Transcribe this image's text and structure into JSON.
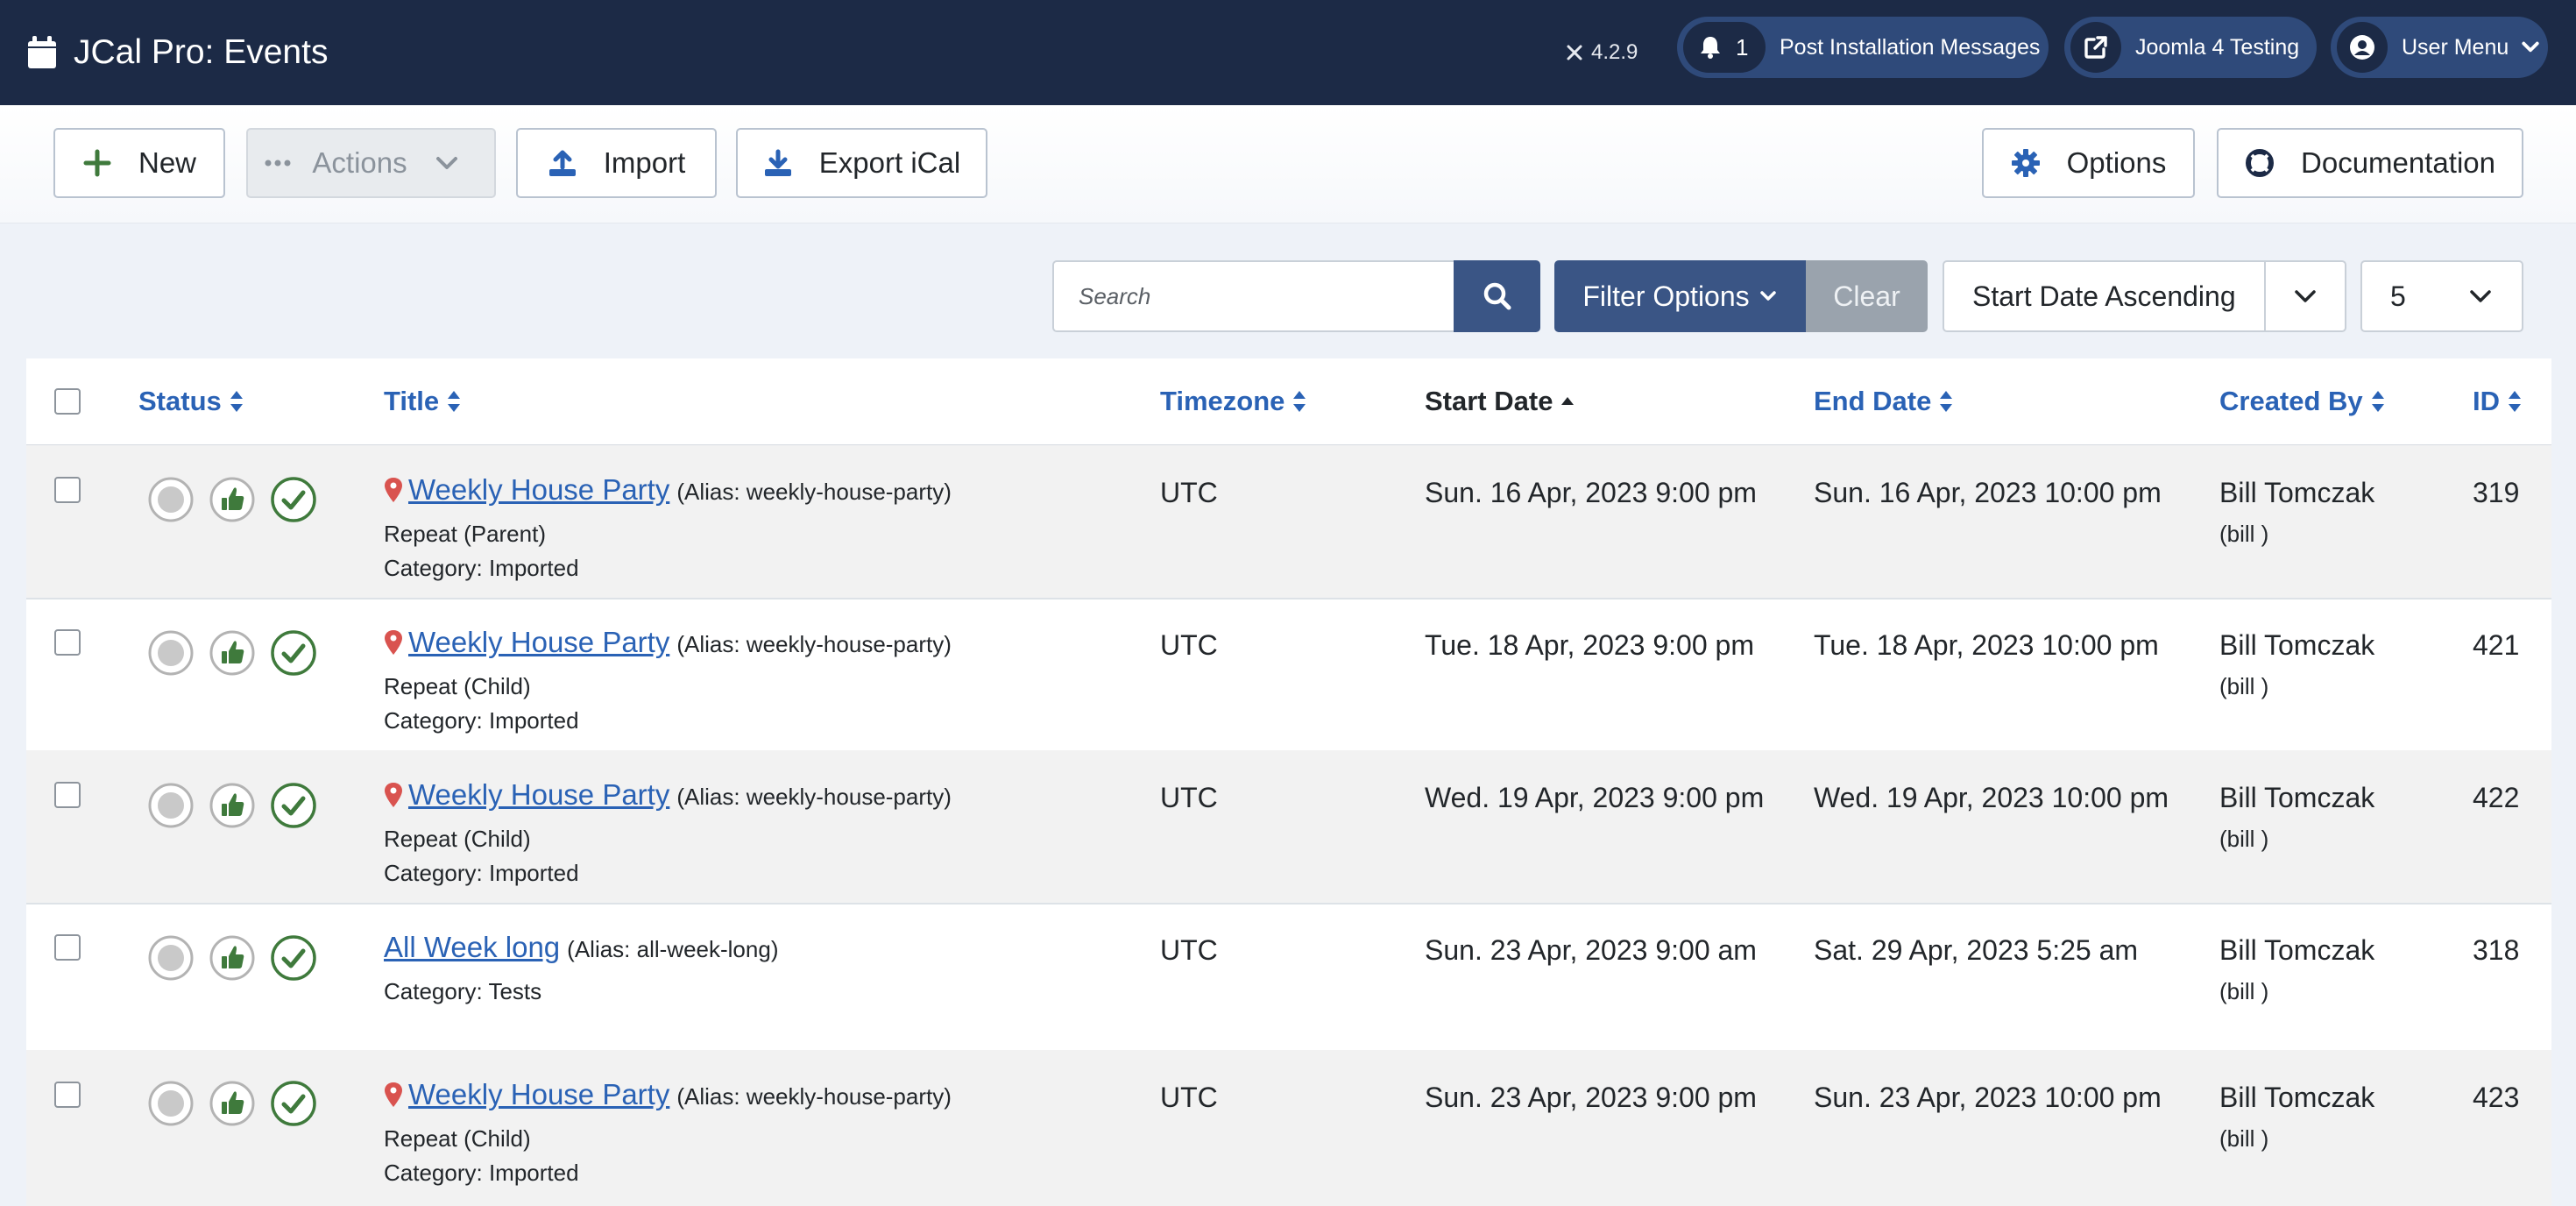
{
  "header": {
    "title": "JCal Pro: Events",
    "version": "4.2.9",
    "notifications": {
      "count": "1",
      "label": "Post Installation Messages"
    },
    "site_link": "Joomla 4 Testing",
    "user_menu": "User Menu"
  },
  "toolbar": {
    "new": "New",
    "actions": "Actions",
    "import": "Import",
    "export": "Export iCal",
    "options": "Options",
    "documentation": "Documentation"
  },
  "filters": {
    "search_placeholder": "Search",
    "filter_options": "Filter Options",
    "clear": "Clear",
    "ordering": "Start Date Ascending",
    "limit": "5"
  },
  "table": {
    "columns": {
      "status": "Status",
      "title": "Title",
      "timezone": "Timezone",
      "start": "Start Date",
      "end": "End Date",
      "created_by": "Created By",
      "id": "ID"
    },
    "rows": [
      {
        "title": "Weekly House Party",
        "alias": "(Alias: weekly-house-party)",
        "repeat": "Repeat (Parent)",
        "category": "Category: Imported",
        "timezone": "UTC",
        "start": "Sun. 16 Apr, 2023 9:00 pm",
        "end": "Sun. 16 Apr, 2023 10:00 pm",
        "creator": "Bill Tomczak",
        "username": "(bill )",
        "id": "319",
        "has_location": true
      },
      {
        "title": "Weekly House Party",
        "alias": "(Alias: weekly-house-party)",
        "repeat": "Repeat (Child)",
        "category": "Category: Imported",
        "timezone": "UTC",
        "start": "Tue. 18 Apr, 2023 9:00 pm",
        "end": "Tue. 18 Apr, 2023 10:00 pm",
        "creator": "Bill Tomczak",
        "username": "(bill )",
        "id": "421",
        "has_location": true
      },
      {
        "title": "Weekly House Party",
        "alias": "(Alias: weekly-house-party)",
        "repeat": "Repeat (Child)",
        "category": "Category: Imported",
        "timezone": "UTC",
        "start": "Wed. 19 Apr, 2023 9:00 pm",
        "end": "Wed. 19 Apr, 2023 10:00 pm",
        "creator": "Bill Tomczak",
        "username": "(bill )",
        "id": "422",
        "has_location": true
      },
      {
        "title": "All Week long",
        "alias": "(Alias: all-week-long)",
        "repeat": "",
        "category": "Category: Tests",
        "timezone": "UTC",
        "start": "Sun. 23 Apr, 2023 9:00 am",
        "end": "Sat. 29 Apr, 2023 5:25 am",
        "creator": "Bill Tomczak",
        "username": "(bill )",
        "id": "318",
        "has_location": false
      },
      {
        "title": "Weekly House Party",
        "alias": "(Alias: weekly-house-party)",
        "repeat": "Repeat (Child)",
        "category": "Category: Imported",
        "timezone": "UTC",
        "start": "Sun. 23 Apr, 2023 9:00 pm",
        "end": "Sun. 23 Apr, 2023 10:00 pm",
        "creator": "Bill Tomczak",
        "username": "(bill )",
        "id": "423",
        "has_location": true
      }
    ]
  },
  "colors": {
    "header_bg": "#1c2a46",
    "accent": "#3a5585",
    "link": "#2a62b5",
    "published_green": "#3f7a3c"
  }
}
